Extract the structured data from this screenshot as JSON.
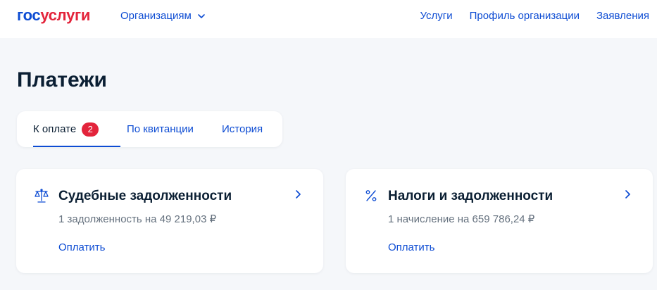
{
  "header": {
    "logo_part1": "гос",
    "logo_part2": "услуги",
    "org_menu_label": "Организациям",
    "nav": [
      "Услуги",
      "Профиль организации",
      "Заявления"
    ]
  },
  "page": {
    "title": "Платежи"
  },
  "tabs": [
    {
      "label": "К оплате",
      "badge": "2",
      "active": true
    },
    {
      "label": "По квитанции",
      "active": false
    },
    {
      "label": "История",
      "active": false
    }
  ],
  "cards": [
    {
      "icon": "scales-icon",
      "title": "Судебные задолженности",
      "subtitle": "1 задолженность на 49 219,03 ₽",
      "action": "Оплатить"
    },
    {
      "icon": "percent-icon",
      "title": "Налоги и задолженности",
      "subtitle": "1 начисление на 659 786,24 ₽",
      "action": "Оплатить"
    }
  ],
  "colors": {
    "brand_blue": "#0d4cd3",
    "brand_red": "#e3243b",
    "text_dark": "#0b1f33",
    "text_muted": "#66727f",
    "background": "#f5f7fa"
  }
}
